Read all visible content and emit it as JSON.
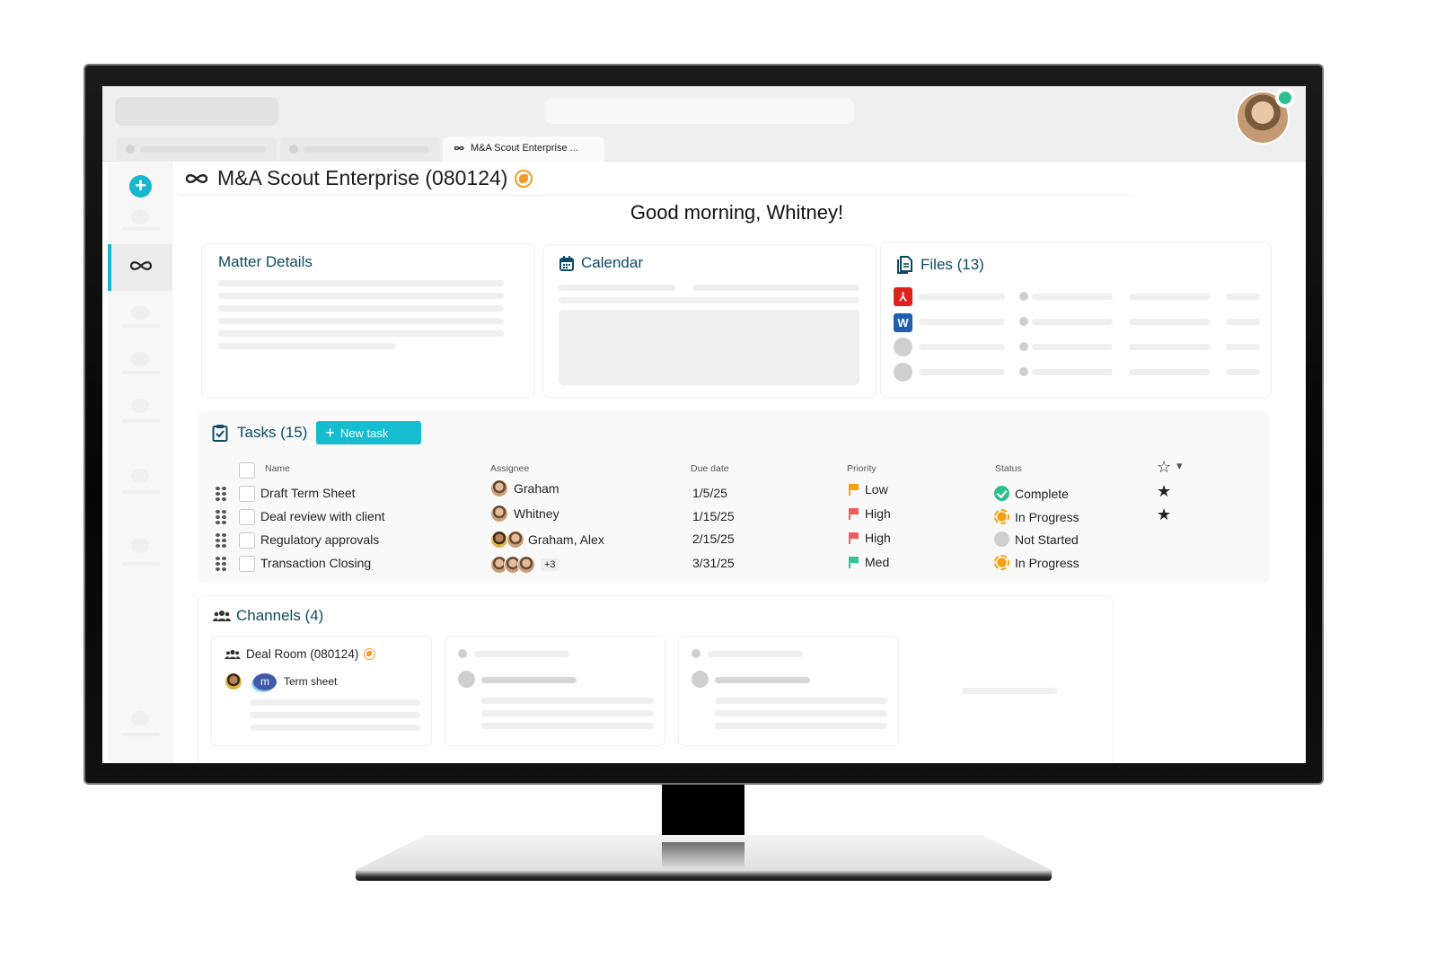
{
  "browser": {
    "active_tab_label": "M&A Scout Enterprise ...",
    "active_tab_icon": "infinity-icon"
  },
  "user": {
    "presence_status": "online",
    "presence_color": "#2fbf8f"
  },
  "sidebar": {
    "add_button_icon": "plus-icon",
    "active_item_icon": "infinity-icon",
    "accent_color": "#16b8cf"
  },
  "matter": {
    "title": "M&A Scout Enterprise (080124)",
    "title_icon": "infinity-icon",
    "badge_icon": "globe-icon"
  },
  "greeting": "Good morning, Whitney!",
  "cards": {
    "matter_details": {
      "title": "Matter Details"
    },
    "calendar": {
      "title": "Calendar",
      "icon": "calendar-icon"
    },
    "files": {
      "title": "Files (13)",
      "icon": "files-icon",
      "file_types": [
        "pdf",
        "word",
        "unknown",
        "unknown"
      ],
      "pdf_glyph": "⅄",
      "word_glyph": "W"
    }
  },
  "tasks": {
    "title": "Tasks (15)",
    "icon": "clipboard-check-icon",
    "new_task_label": "New task",
    "new_task_plus": "+",
    "columns": {
      "name": "Name",
      "assignee": "Assignee",
      "due_date": "Due date",
      "priority": "Priority",
      "status": "Status"
    },
    "favorite_header_icon": "☆",
    "favorite_dropdown_icon": "▾",
    "rows": [
      {
        "name": "Draft Term Sheet",
        "assignee": "Graham",
        "due": "1/5/25",
        "priority": "Low",
        "priority_color": "#f5a00f",
        "status": "Complete",
        "status_type": "complete",
        "starred": true,
        "star": "★"
      },
      {
        "name": "Deal review with client",
        "assignee": "Whitney",
        "due": "1/15/25",
        "priority": "High",
        "priority_color": "#ef5b5b",
        "status": "In Progress",
        "status_type": "progress",
        "starred": true,
        "star": "★"
      },
      {
        "name": "Regulatory approvals",
        "assignee": "Graham, Alex",
        "due": "2/15/25",
        "priority": "High",
        "priority_color": "#ef5b5b",
        "status": "Not Started",
        "status_type": "notstarted",
        "starred": false,
        "star": ""
      },
      {
        "name": "Transaction Closing",
        "assignee": "",
        "assignee_more": "+3",
        "due": "3/31/25",
        "priority": "Med",
        "priority_color": "#35c29a",
        "status": "In Progress",
        "status_type": "progress",
        "starred": false,
        "star": ""
      }
    ]
  },
  "channels": {
    "title": "Channels (4)",
    "icon": "people-icon",
    "items": [
      {
        "name": "Deal Room (080124)",
        "icon": "people-icon",
        "badge_icon": "globe-icon",
        "message_app_glyph": "m",
        "message_preview": "Term sheet"
      }
    ]
  }
}
